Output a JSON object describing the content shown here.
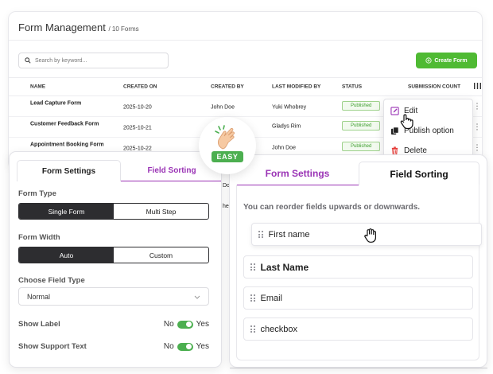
{
  "management": {
    "title": "Form Management",
    "count_label": "/ 10 Forms",
    "search_placeholder": "Search by keyword...",
    "create_button": "Create Form",
    "columns": [
      "NAME",
      "CREATED ON",
      "CREATED BY",
      "LAST MODIFIED BY",
      "STATUS",
      "SUBMISSION COUNT"
    ],
    "rows": [
      {
        "name": "Lead Capture Form",
        "created_on": "2025-10-20",
        "created_by": "John Doe",
        "modified_by": "Yuki Whobrey",
        "status": "Published"
      },
      {
        "name": "Customer Feedback Form",
        "created_on": "2025-10-21",
        "created_by": "",
        "modified_by": "Gladys Rim",
        "status": "Published"
      },
      {
        "name": "Appointment Booking Form",
        "created_on": "2025-10-22",
        "created_by": "",
        "modified_by": "John Doe",
        "status": "Published"
      }
    ],
    "partial_cells": [
      "Do",
      "he"
    ]
  },
  "menu": {
    "items": [
      {
        "label": "Edit",
        "icon": "edit-icon",
        "color": "#9a33b5"
      },
      {
        "label": "Publish option",
        "icon": "copy-icon",
        "color": "#222222"
      },
      {
        "label": "Delete",
        "icon": "trash-icon",
        "color": "#e53935"
      }
    ]
  },
  "easy_badge": {
    "label": "EASY",
    "icon": "hand-snap-icon"
  },
  "settings": {
    "tabs": [
      "Form Settings",
      "Field Sorting"
    ],
    "form_type": {
      "label": "Form Type",
      "options": [
        "Single Form",
        "Multi Step"
      ],
      "selected": "Single Form"
    },
    "form_width": {
      "label": "Form Width",
      "options": [
        "Auto",
        "Custom"
      ],
      "selected": "Auto"
    },
    "field_type": {
      "label": "Choose Field Type",
      "value": "Normal"
    },
    "show_label": {
      "label": "Show Label",
      "off": "No",
      "on": "Yes",
      "value": true
    },
    "show_support": {
      "label": "Show Support Text",
      "off": "No",
      "on": "Yes",
      "value": true
    }
  },
  "sorting": {
    "tabs": [
      "Form Settings",
      "Field Sorting"
    ],
    "hint": "You can reorder fields upwards or downwards.",
    "fields": [
      "First name",
      "Last Name",
      "Email",
      "checkbox"
    ]
  },
  "colors": {
    "accent": "#9a33b5",
    "green": "#4caf50",
    "dark": "#2d2d30",
    "danger": "#e53935"
  }
}
